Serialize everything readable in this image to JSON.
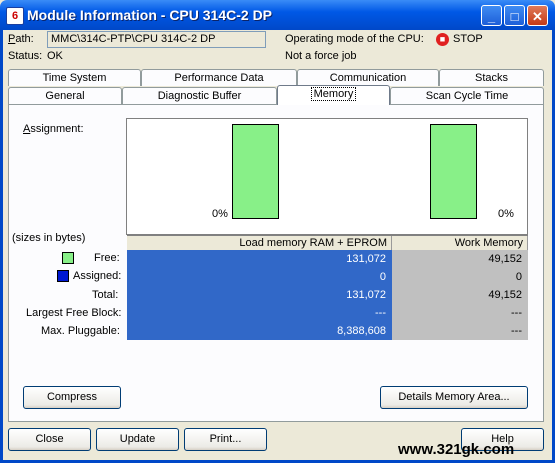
{
  "window": {
    "title": "Module Information - CPU 314C-2 DP",
    "icon_label": "6"
  },
  "header": {
    "path_label": "Path:",
    "path_value": "MMC\\314C-PTP\\CPU 314C-2 DP",
    "status_label": "Status:",
    "status_value": "OK",
    "op_mode_label": "Operating mode of the  CPU:",
    "op_mode_value": "STOP",
    "force_text": "Not a force job"
  },
  "tabs": {
    "row1": [
      "Time System",
      "Performance Data",
      "Communication",
      "Stacks"
    ],
    "row2": [
      "General",
      "Diagnostic Buffer",
      "Memory",
      "Scan Cycle Time"
    ],
    "active": "Memory"
  },
  "memory": {
    "assignment_label": "Assignment:",
    "sizes_label": "(sizes in bytes)",
    "load_memory_percent_label": "0%",
    "work_memory_percent_label": "0%",
    "load_memory_used_percent": 0,
    "work_memory_used_percent": 0,
    "columns": [
      "Load memory RAM + EPROM",
      "Work Memory"
    ],
    "rows": [
      {
        "label": "Free:",
        "load": "131,072",
        "work": "49,152"
      },
      {
        "label": "Assigned:",
        "load": "0",
        "work": "0"
      },
      {
        "label": "Total:",
        "load": "131,072",
        "work": "49,152"
      },
      {
        "label": "Largest Free Block:",
        "load": "---",
        "work": "---"
      },
      {
        "label": "Max. Pluggable:",
        "load": "8,388,608",
        "work": "---"
      }
    ],
    "compress_label": "Compress",
    "details_label": "Details Memory Area..."
  },
  "footer": {
    "close": "Close",
    "update": "Update",
    "print": "Print...",
    "help": "Help"
  },
  "watermark": "www.321gk.com",
  "colors": {
    "free": "#88f088",
    "assigned": "#0018d0",
    "load_fill": "#3168c8",
    "work_fill": "#c0c0c0"
  }
}
